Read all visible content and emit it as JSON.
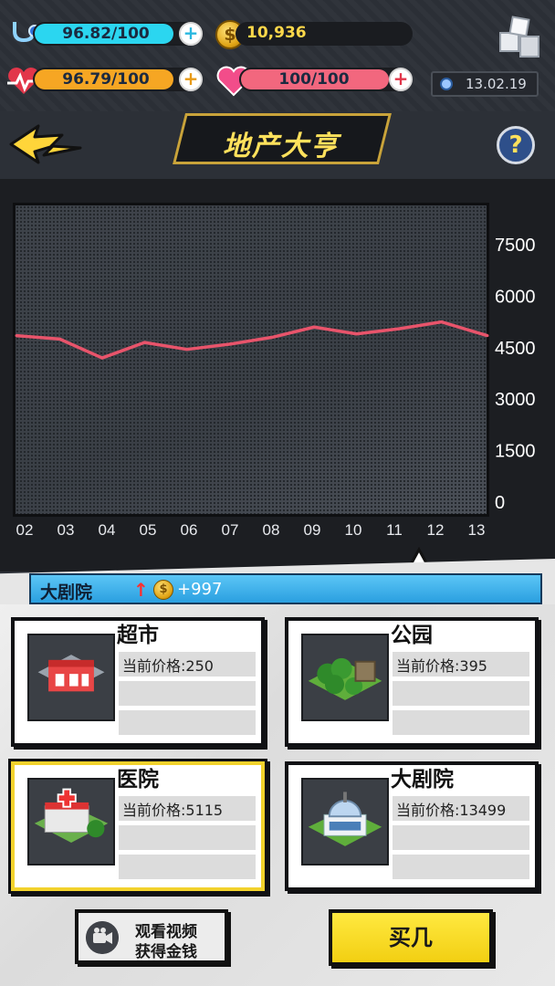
{
  "hud": {
    "health": {
      "text": "96.82/100",
      "value": 0.9682,
      "color": "#2bd6f0"
    },
    "energy": {
      "text": "96.79/100",
      "value": 0.9679,
      "color": "#f6a623"
    },
    "love": {
      "text": "100/100",
      "value": 1.0,
      "color": "#f2677e"
    },
    "coins": "10,936",
    "coin_symbol": "$",
    "plus_symbol": "+",
    "date": "13.02.19"
  },
  "header": {
    "title": "地产大亨",
    "help": "?"
  },
  "chart_data": {
    "type": "line",
    "x": [
      "02",
      "03",
      "04",
      "05",
      "06",
      "07",
      "08",
      "09",
      "10",
      "11",
      "12",
      "13"
    ],
    "values": [
      4850,
      4750,
      4200,
      4650,
      4450,
      4600,
      4800,
      5100,
      4900,
      5050,
      5250,
      4850
    ],
    "yticks": [
      0,
      1500,
      3000,
      4500,
      6000,
      7500
    ],
    "ylim": [
      0,
      8000
    ],
    "line_color": "#e8546b",
    "grid": false
  },
  "ticker": {
    "name": "大剧院",
    "arrow": "↑",
    "coin_symbol": "$",
    "amount": "+997"
  },
  "properties": [
    {
      "name": "超市",
      "price": "当前价格:250"
    },
    {
      "name": "公园",
      "price": "当前价格:395"
    },
    {
      "name": "医院",
      "price": "当前价格:5115"
    },
    {
      "name": "大剧院",
      "price": "当前价格:13499"
    }
  ],
  "buttons": {
    "video_line1": "观看视频",
    "video_line2": "获得金钱",
    "buy": "买几"
  }
}
